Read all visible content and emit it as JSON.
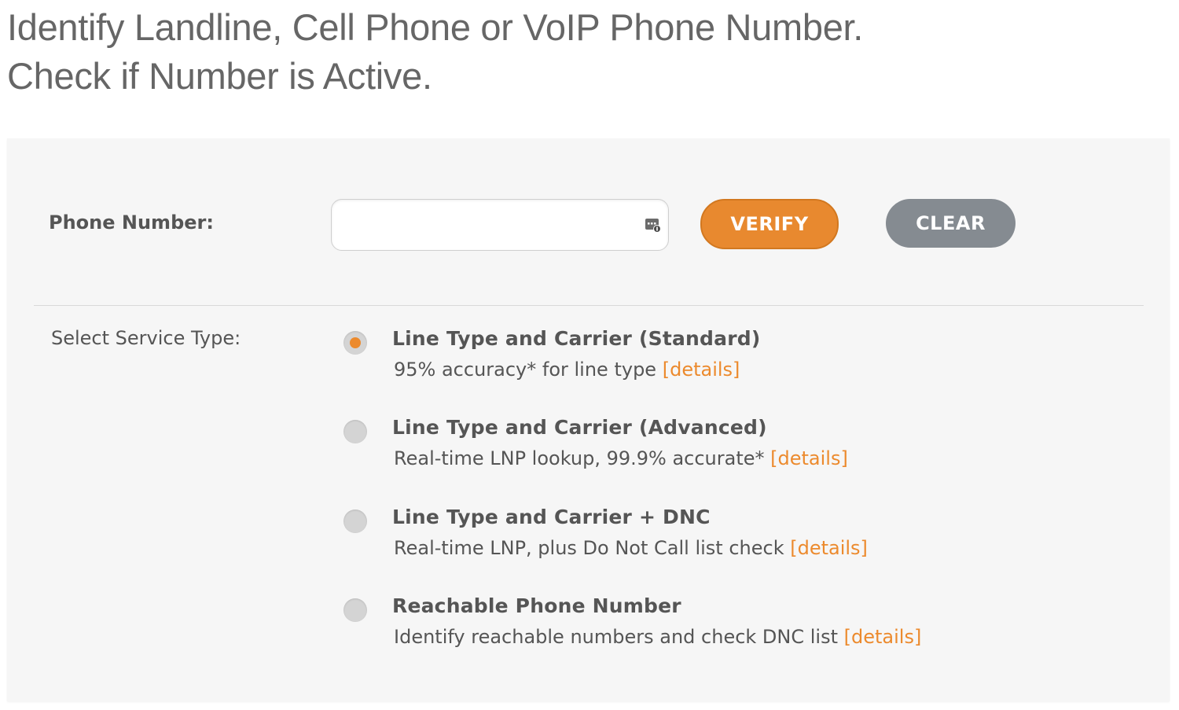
{
  "header": {
    "title_line1": "Identify Landline, Cell Phone or VoIP Phone Number.",
    "title_line2": "Check if Number is Active."
  },
  "form": {
    "phone_label": "Phone Number:",
    "phone_value": "",
    "phone_placeholder": "",
    "verify_label": "VERIFY",
    "clear_label": "CLEAR",
    "service_label": "Select Service Type:",
    "options": [
      {
        "title": "Line Type and Carrier (Standard)",
        "desc": "95% accuracy* for line type",
        "link": "[details]",
        "selected": true
      },
      {
        "title": "Line Type and Carrier (Advanced)",
        "desc": "Real-time LNP lookup, 99.9% accurate*",
        "link": "[details]",
        "selected": false
      },
      {
        "title": "Line Type and Carrier + DNC",
        "desc": "Real-time LNP, plus Do Not Call list check",
        "link": "[details]",
        "selected": false
      },
      {
        "title": "Reachable Phone Number",
        "desc": "Identify reachable numbers and check DNC list",
        "link": "[details]",
        "selected": false
      }
    ]
  },
  "colors": {
    "accent": "#ec8a2d",
    "verify_button": "#e8892f",
    "clear_button": "#858b91",
    "panel_background": "#f6f6f6",
    "text": "#555555",
    "title_text": "#666666"
  },
  "icons": {
    "input_icon": "contact-card-icon",
    "radio_icon": "radio-button"
  }
}
